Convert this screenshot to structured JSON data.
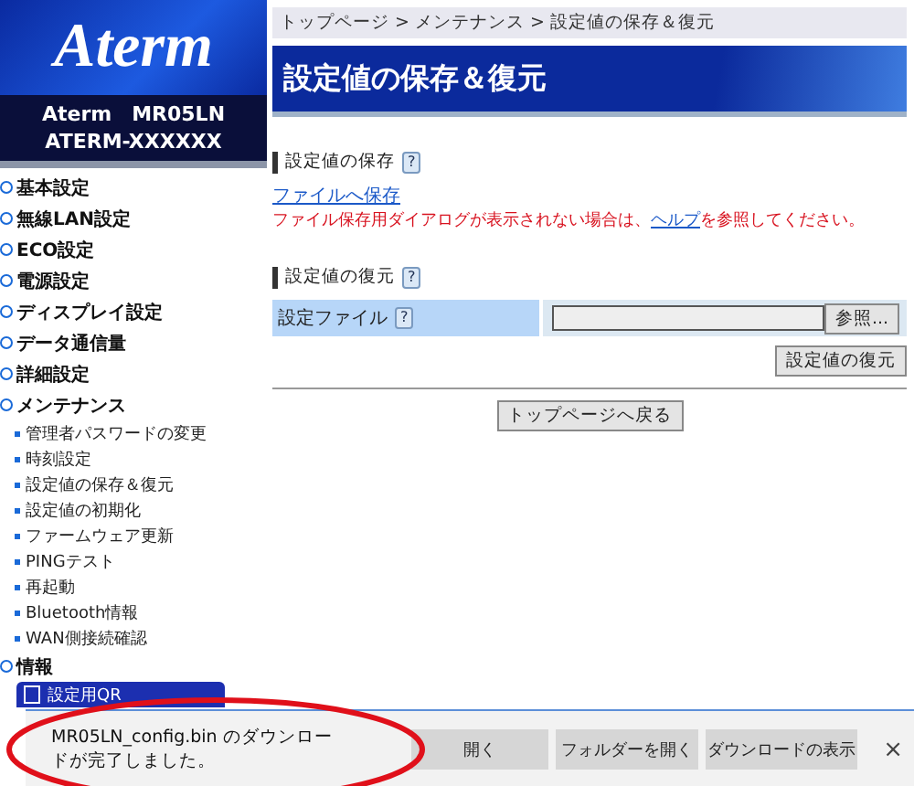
{
  "sidebar": {
    "logo": "Aterm",
    "model": [
      "Aterm　MR05LN",
      "ATERM-XXXXXX"
    ],
    "menu": [
      {
        "label": "基本設定"
      },
      {
        "label": "無線LAN設定"
      },
      {
        "label": "ECO設定"
      },
      {
        "label": "電源設定"
      },
      {
        "label": "ディスプレイ設定"
      },
      {
        "label": "データ通信量"
      },
      {
        "label": "詳細設定"
      },
      {
        "label": "メンテナンス",
        "children": [
          {
            "label": "管理者パスワードの変更"
          },
          {
            "label": "時刻設定"
          },
          {
            "label": "設定値の保存＆復元"
          },
          {
            "label": "設定値の初期化"
          },
          {
            "label": "ファームウェア更新"
          },
          {
            "label": "PINGテスト"
          },
          {
            "label": "再起動"
          },
          {
            "label": "Bluetooth情報"
          },
          {
            "label": "WAN側接続確認"
          }
        ]
      },
      {
        "label": "情報"
      }
    ],
    "qr_button": "設定用QR"
  },
  "main": {
    "breadcrumb": "トップページ > メンテナンス > 設定値の保存＆復元",
    "title": "設定値の保存＆復元",
    "save_section": {
      "heading": "設定値の保存",
      "help": "?",
      "link": "ファイルへ保存",
      "note_before": "ファイル保存用ダイアログが表示されない場合は、",
      "note_link": "ヘルプ",
      "note_after": "を参照してください。"
    },
    "restore_section": {
      "heading": "設定値の復元",
      "help": "?",
      "field_label": "設定ファイル",
      "field_help": "?",
      "browse_button": "参照...",
      "restore_button": "設定値の復元"
    },
    "back_button": "トップページへ戻る"
  },
  "download_bar": {
    "message": "MR05LN_config.bin のダウンロードが完了しました。",
    "buttons": [
      "開く",
      "フォルダーを開く",
      "ダウンロードの表示"
    ],
    "close": "×"
  }
}
